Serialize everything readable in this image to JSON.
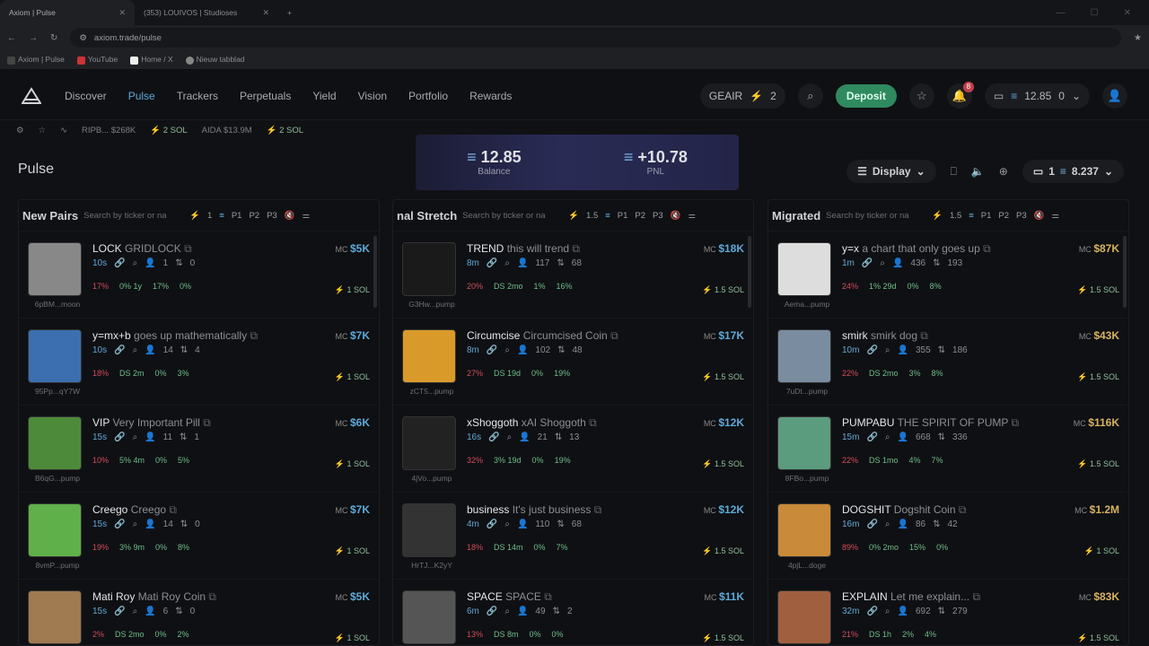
{
  "browser": {
    "tabs": [
      {
        "title": "Axiom | Pulse"
      },
      {
        "title": "(353) LOUIVOS | Studioses"
      }
    ],
    "url": "axiom.trade/pulse",
    "bookmarks": [
      "Axiom | Pulse",
      "YouTube",
      "Home / X",
      "Nieuw tabblad"
    ]
  },
  "nav": {
    "links": [
      "Discover",
      "Pulse",
      "Trackers",
      "Perpetuals",
      "Yield",
      "Vision",
      "Portfolio",
      "Rewards"
    ],
    "user": "GEAIR",
    "points": "2",
    "deposit": "Deposit",
    "notif_count": "8",
    "balance": "12.85",
    "other": "0"
  },
  "ticker": [
    {
      "name": "RIPB...",
      "mc": "$268K",
      "sol": "2 SOL"
    },
    {
      "name": "AIDA",
      "mc": "$13.9M",
      "sol": "2 SOL"
    }
  ],
  "page": {
    "title": "Pulse",
    "balance_value": "12.85",
    "balance_label": "Balance",
    "pnl_value": "+10.78",
    "pnl_label": "PNL",
    "display": "Display",
    "wallet_count": "1",
    "wallet_balance": "8.237"
  },
  "columns": [
    {
      "title": "New Pairs",
      "search": "Search by ticker or na",
      "quick": "1",
      "presets": [
        "P1",
        "P2",
        "P3"
      ],
      "cards": [
        {
          "ticker": "LOCK",
          "name": "GRIDLOCK",
          "age": "10s",
          "holders": "1",
          "tx": "0",
          "mc": "$5K",
          "stats": [
            "17%",
            "0% 1y",
            "17%",
            "0%"
          ],
          "addr": "6pBM...moon",
          "buy": "1 SOL",
          "color": "#888"
        },
        {
          "ticker": "y=mx+b",
          "name": "goes up mathematically",
          "age": "10s",
          "holders": "14",
          "tx": "4",
          "mc": "$7K",
          "stats": [
            "18%",
            "DS 2m",
            "0%",
            "3%"
          ],
          "addr": "95Pp...qY7W",
          "buy": "1 SOL",
          "color": "#3b6fb0"
        },
        {
          "ticker": "VIP",
          "name": "Very Important Pill",
          "age": "15s",
          "holders": "11",
          "tx": "1",
          "mc": "$6K",
          "stats": [
            "10%",
            "5% 4m",
            "0%",
            "5%"
          ],
          "addr": "B6qG...pump",
          "buy": "1 SOL",
          "color": "#4d8b3a"
        },
        {
          "ticker": "Creego",
          "name": "Creego",
          "age": "15s",
          "holders": "14",
          "tx": "0",
          "mc": "$7K",
          "stats": [
            "19%",
            "3% 9m",
            "0%",
            "8%"
          ],
          "addr": "8vmP...pump",
          "buy": "1 SOL",
          "color": "#5fb04a"
        },
        {
          "ticker": "Mati Roy",
          "name": "Mati Roy Coin",
          "age": "15s",
          "holders": "6",
          "tx": "0",
          "mc": "$5K",
          "stats": [
            "2%",
            "DS 2mo",
            "0%",
            "2%"
          ],
          "addr": "",
          "buy": "1 SOL",
          "color": "#a07a50"
        }
      ]
    },
    {
      "title": "nal Stretch",
      "search": "Search by ticker or na",
      "quick": "1.5",
      "presets": [
        "P1",
        "P2",
        "P3"
      ],
      "cards": [
        {
          "ticker": "TREND",
          "name": "this will trend",
          "age": "8m",
          "holders": "117",
          "tx": "68",
          "mc": "$18K",
          "stats": [
            "20%",
            "DS 2mo",
            "1%",
            "16%"
          ],
          "addr": "G3Hw...pump",
          "buy": "1.5 SOL",
          "color": "#1a1a1a"
        },
        {
          "ticker": "Circumcise",
          "name": "Circumcised Coin",
          "age": "8m",
          "holders": "102",
          "tx": "48",
          "mc": "$17K",
          "stats": [
            "27%",
            "DS 19d",
            "0%",
            "19%"
          ],
          "addr": "zCT5...pump",
          "buy": "1.5 SOL",
          "color": "#d99a2a"
        },
        {
          "ticker": "xShoggoth",
          "name": "xAI Shoggoth",
          "age": "16s",
          "holders": "21",
          "tx": "13",
          "mc": "$12K",
          "stats": [
            "32%",
            "3% 19d",
            "0%",
            "19%"
          ],
          "addr": "4jVo...pump",
          "buy": "1.5 SOL",
          "color": "#222"
        },
        {
          "ticker": "business",
          "name": "It's just business",
          "age": "4m",
          "holders": "110",
          "tx": "68",
          "mc": "$12K",
          "stats": [
            "18%",
            "DS 14m",
            "0%",
            "7%"
          ],
          "addr": "HrTJ...K2yY",
          "buy": "1.5 SOL",
          "color": "#333"
        },
        {
          "ticker": "SPACE",
          "name": "SPACE",
          "age": "6m",
          "holders": "49",
          "tx": "2",
          "mc": "$11K",
          "stats": [
            "13%",
            "DS 8m",
            "0%",
            "0%"
          ],
          "addr": "",
          "buy": "1.5 SOL",
          "color": "#555"
        }
      ]
    },
    {
      "title": "Migrated",
      "search": "Search by ticker or na",
      "quick": "1.5",
      "presets": [
        "P1",
        "P2",
        "P3"
      ],
      "cards": [
        {
          "ticker": "y=x",
          "name": "a chart that only goes up",
          "age": "1m",
          "holders": "436",
          "tx": "193",
          "mc": "$87K",
          "stats": [
            "24%",
            "1% 29d",
            "0%",
            "8%"
          ],
          "addr": "Aema...pump",
          "buy": "1.5 SOL",
          "color": "#ddd"
        },
        {
          "ticker": "smirk",
          "name": "smirk dog",
          "age": "10m",
          "holders": "355",
          "tx": "186",
          "mc": "$43K",
          "stats": [
            "22%",
            "DS 2mo",
            "3%",
            "8%"
          ],
          "addr": "7uDt...pump",
          "buy": "1.5 SOL",
          "color": "#7a8ca0"
        },
        {
          "ticker": "PUMPABU",
          "name": "THE SPIRIT OF PUMP",
          "age": "15m",
          "holders": "668",
          "tx": "336",
          "mc": "$116K",
          "stats": [
            "22%",
            "DS 1mo",
            "4%",
            "7%"
          ],
          "addr": "8FBo...pump",
          "buy": "1.5 SOL",
          "color": "#5c9c7e"
        },
        {
          "ticker": "DOGSHIT",
          "name": "Dogshit Coin",
          "age": "16m",
          "holders": "86",
          "tx": "42",
          "mc": "$1.2M",
          "stats": [
            "89%",
            "0% 2mo",
            "15%",
            "0%"
          ],
          "addr": "4pjL...doge",
          "buy": "1 SOL",
          "color": "#c98a3a"
        },
        {
          "ticker": "EXPLAIN",
          "name": "Let me explain...",
          "age": "32m",
          "holders": "692",
          "tx": "279",
          "mc": "$83K",
          "stats": [
            "21%",
            "DS 1h",
            "2%",
            "4%"
          ],
          "addr": "",
          "buy": "1.5 SOL",
          "color": "#a06040"
        }
      ]
    }
  ]
}
